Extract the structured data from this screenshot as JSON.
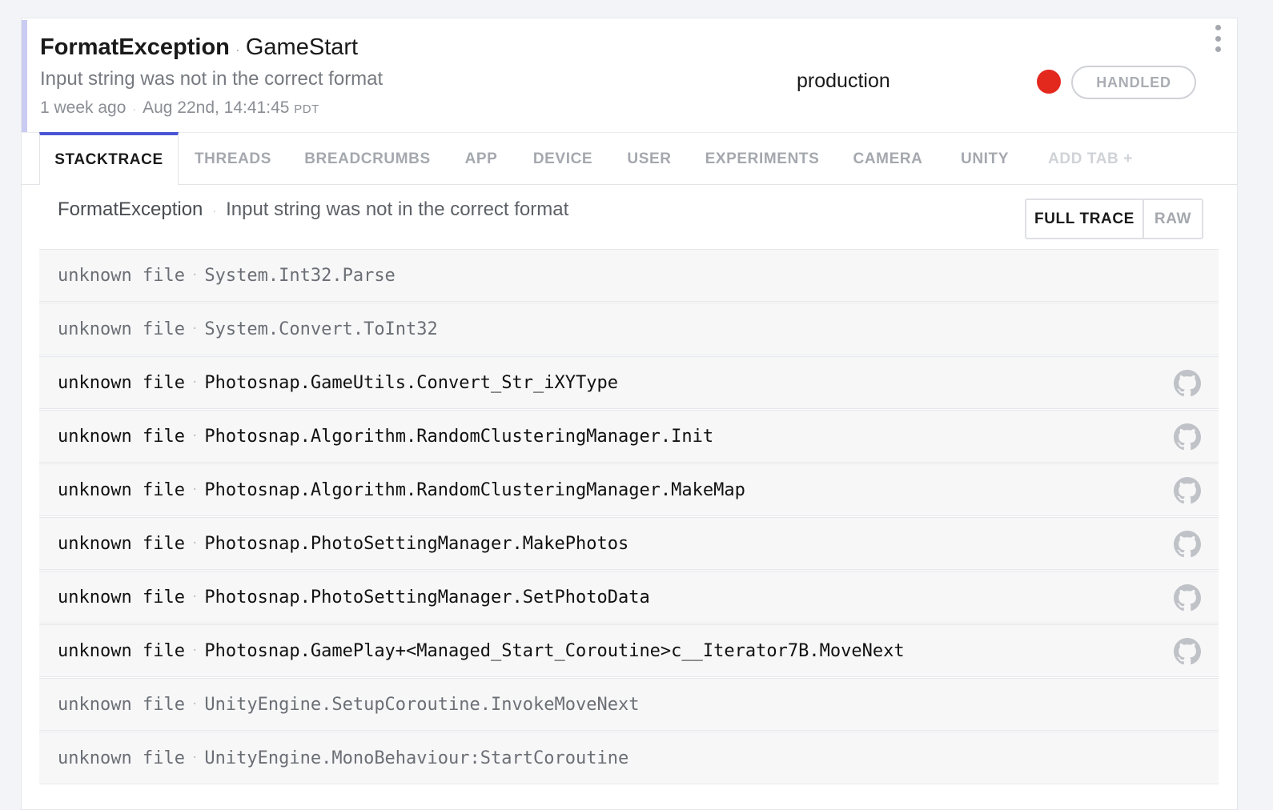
{
  "error": {
    "class": "FormatException",
    "context": "GameStart",
    "message": "Input string was not in the correct format",
    "relative_time": "1 week ago",
    "timestamp": "Aug 22nd, 14:41:45",
    "timezone": "PDT",
    "release_stage": "production",
    "severity_color": "#e3281e",
    "handled_label": "HANDLED"
  },
  "tabs": [
    {
      "label": "STACKTRACE",
      "active": true
    },
    {
      "label": "THREADS"
    },
    {
      "label": "BREADCRUMBS"
    },
    {
      "label": "APP"
    },
    {
      "label": "DEVICE"
    },
    {
      "label": "USER"
    },
    {
      "label": "EXPERIMENTS"
    },
    {
      "label": "CAMERA"
    },
    {
      "label": "UNITY"
    },
    {
      "label": "ADD TAB +"
    }
  ],
  "stacktrace": {
    "class": "FormatException",
    "message": "Input string was not in the correct format",
    "full_trace_label": "FULL TRACE",
    "raw_label": "RAW",
    "frames": [
      {
        "file": "unknown file",
        "method": "System.Int32.Parse",
        "in_project": false
      },
      {
        "file": "unknown file",
        "method": "System.Convert.ToInt32",
        "in_project": false
      },
      {
        "file": "unknown file",
        "method": "Photosnap.GameUtils.Convert_Str_iXYType",
        "in_project": true
      },
      {
        "file": "unknown file",
        "method": "Photosnap.Algorithm.RandomClusteringManager.Init",
        "in_project": true
      },
      {
        "file": "unknown file",
        "method": "Photosnap.Algorithm.RandomClusteringManager.MakeMap",
        "in_project": true
      },
      {
        "file": "unknown file",
        "method": "Photosnap.PhotoSettingManager.MakePhotos",
        "in_project": true
      },
      {
        "file": "unknown file",
        "method": "Photosnap.PhotoSettingManager.SetPhotoData",
        "in_project": true
      },
      {
        "file": "unknown file",
        "method": "Photosnap.GamePlay+<Managed_Start_Coroutine>c__Iterator7B.MoveNext",
        "in_project": true
      },
      {
        "file": "unknown file",
        "method": "UnityEngine.SetupCoroutine.InvokeMoveNext",
        "in_project": false
      },
      {
        "file": "unknown file",
        "method": "UnityEngine.MonoBehaviour:StartCoroutine",
        "in_project": false
      }
    ]
  },
  "icons": {
    "more": "vertical-ellipsis-icon",
    "source_link": "github-icon"
  },
  "colors": {
    "accent": "#4a55d6",
    "accent_bar": "#c9cbf2"
  }
}
